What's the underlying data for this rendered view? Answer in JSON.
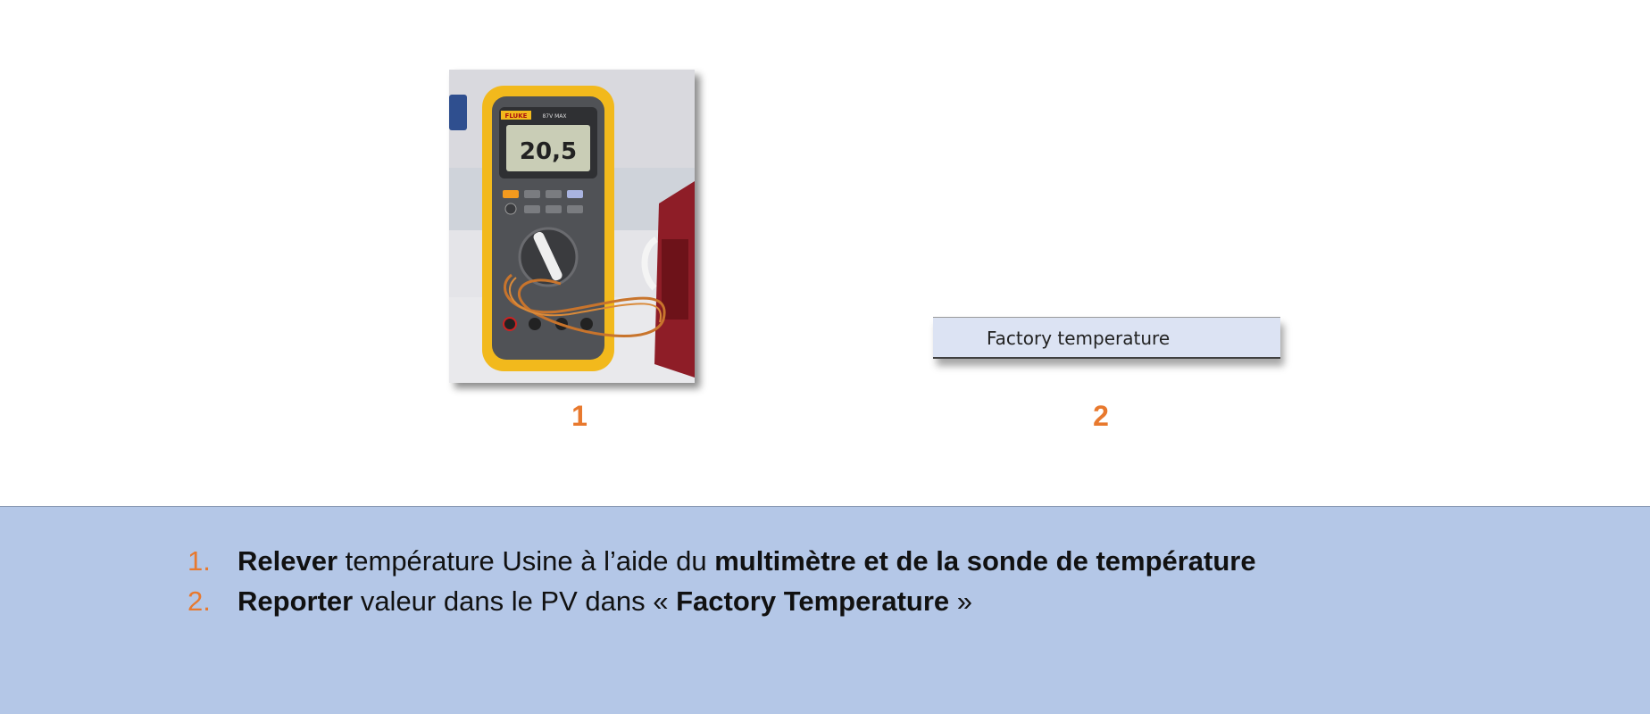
{
  "figures": [
    {
      "number": "1",
      "display_reading": "20,5",
      "brand": "FLUKE",
      "model": "87V MAX"
    },
    {
      "number": "2",
      "field_label": "Factory temperature"
    }
  ],
  "instructions": [
    {
      "num": "1.",
      "parts": [
        "Relever",
        " température Usine à l’aide du ",
        "multimètre et de la sonde de température"
      ]
    },
    {
      "num": "2.",
      "parts": [
        "Reporter",
        " valeur dans le PV dans « ",
        "Factory Temperature",
        " »"
      ]
    }
  ],
  "colors": {
    "accent": "#e8792e",
    "panel": "#b4c7e7",
    "field": "#dce3f3"
  }
}
